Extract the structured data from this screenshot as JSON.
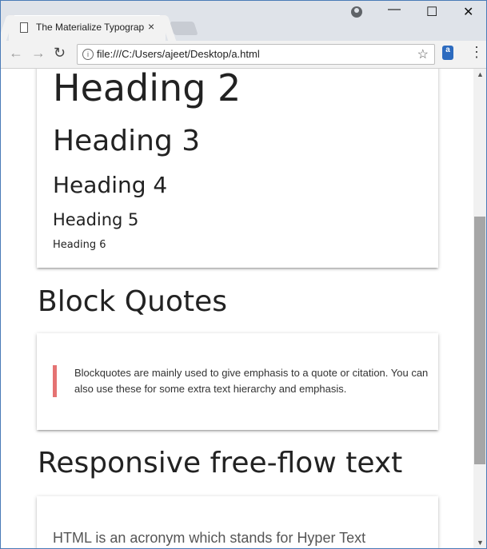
{
  "browser": {
    "tab_title": "The Materialize Typograp",
    "url": "file:///C:/Users/ajeet/Desktop/a.html",
    "icons": {
      "back": "←",
      "forward": "→",
      "reload": "↻",
      "star": "☆",
      "menu": "⋮",
      "tab_close": "×",
      "minimize": "—",
      "maximize": "☐",
      "close": "✕",
      "info": "i",
      "scroll_up": "▲",
      "scroll_down": "▼",
      "extension": "a"
    }
  },
  "page": {
    "headings": {
      "h2": "Heading 2",
      "h3": "Heading 3",
      "h4": "Heading 4",
      "h5": "Heading 5",
      "h6": "Heading 6"
    },
    "block_quotes_title": "Block Quotes",
    "blockquote_text": "Blockquotes are mainly used to give emphasis to a quote or citation. You can also use these for some extra text hierarchy and emphasis.",
    "responsive_title": "Responsive free-flow text",
    "responsive_text": "HTML is an acronym which stands for Hyper Text"
  },
  "colors": {
    "blockquote_border": "#e57373",
    "window_frame": "#4a7bb7",
    "scrollbar_thumb": "#a6a6a6"
  }
}
